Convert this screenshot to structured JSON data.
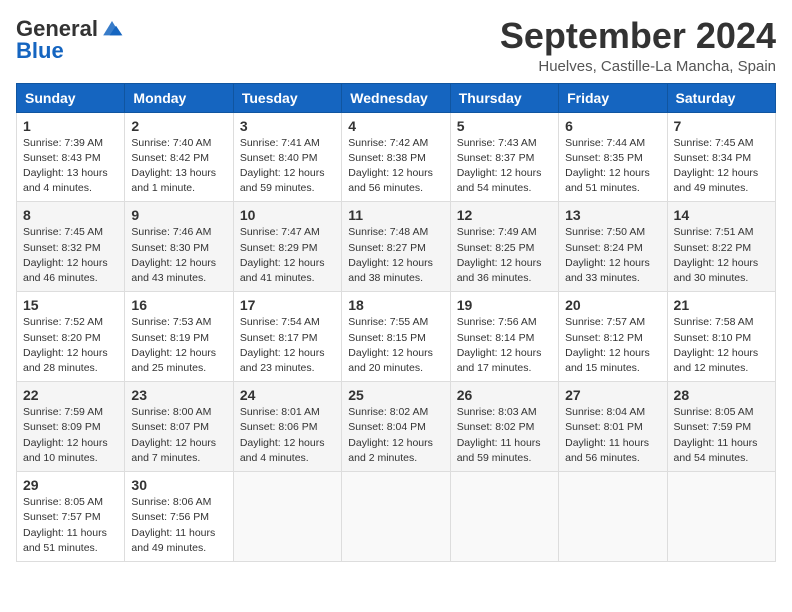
{
  "logo": {
    "general": "General",
    "blue": "Blue"
  },
  "title": {
    "month_year": "September 2024",
    "location": "Huelves, Castille-La Mancha, Spain"
  },
  "weekdays": [
    "Sunday",
    "Monday",
    "Tuesday",
    "Wednesday",
    "Thursday",
    "Friday",
    "Saturday"
  ],
  "weeks": [
    [
      {
        "day": "1",
        "info": "Sunrise: 7:39 AM\nSunset: 8:43 PM\nDaylight: 13 hours\nand 4 minutes."
      },
      {
        "day": "2",
        "info": "Sunrise: 7:40 AM\nSunset: 8:42 PM\nDaylight: 13 hours\nand 1 minute."
      },
      {
        "day": "3",
        "info": "Sunrise: 7:41 AM\nSunset: 8:40 PM\nDaylight: 12 hours\nand 59 minutes."
      },
      {
        "day": "4",
        "info": "Sunrise: 7:42 AM\nSunset: 8:38 PM\nDaylight: 12 hours\nand 56 minutes."
      },
      {
        "day": "5",
        "info": "Sunrise: 7:43 AM\nSunset: 8:37 PM\nDaylight: 12 hours\nand 54 minutes."
      },
      {
        "day": "6",
        "info": "Sunrise: 7:44 AM\nSunset: 8:35 PM\nDaylight: 12 hours\nand 51 minutes."
      },
      {
        "day": "7",
        "info": "Sunrise: 7:45 AM\nSunset: 8:34 PM\nDaylight: 12 hours\nand 49 minutes."
      }
    ],
    [
      {
        "day": "8",
        "info": "Sunrise: 7:45 AM\nSunset: 8:32 PM\nDaylight: 12 hours\nand 46 minutes."
      },
      {
        "day": "9",
        "info": "Sunrise: 7:46 AM\nSunset: 8:30 PM\nDaylight: 12 hours\nand 43 minutes."
      },
      {
        "day": "10",
        "info": "Sunrise: 7:47 AM\nSunset: 8:29 PM\nDaylight: 12 hours\nand 41 minutes."
      },
      {
        "day": "11",
        "info": "Sunrise: 7:48 AM\nSunset: 8:27 PM\nDaylight: 12 hours\nand 38 minutes."
      },
      {
        "day": "12",
        "info": "Sunrise: 7:49 AM\nSunset: 8:25 PM\nDaylight: 12 hours\nand 36 minutes."
      },
      {
        "day": "13",
        "info": "Sunrise: 7:50 AM\nSunset: 8:24 PM\nDaylight: 12 hours\nand 33 minutes."
      },
      {
        "day": "14",
        "info": "Sunrise: 7:51 AM\nSunset: 8:22 PM\nDaylight: 12 hours\nand 30 minutes."
      }
    ],
    [
      {
        "day": "15",
        "info": "Sunrise: 7:52 AM\nSunset: 8:20 PM\nDaylight: 12 hours\nand 28 minutes."
      },
      {
        "day": "16",
        "info": "Sunrise: 7:53 AM\nSunset: 8:19 PM\nDaylight: 12 hours\nand 25 minutes."
      },
      {
        "day": "17",
        "info": "Sunrise: 7:54 AM\nSunset: 8:17 PM\nDaylight: 12 hours\nand 23 minutes."
      },
      {
        "day": "18",
        "info": "Sunrise: 7:55 AM\nSunset: 8:15 PM\nDaylight: 12 hours\nand 20 minutes."
      },
      {
        "day": "19",
        "info": "Sunrise: 7:56 AM\nSunset: 8:14 PM\nDaylight: 12 hours\nand 17 minutes."
      },
      {
        "day": "20",
        "info": "Sunrise: 7:57 AM\nSunset: 8:12 PM\nDaylight: 12 hours\nand 15 minutes."
      },
      {
        "day": "21",
        "info": "Sunrise: 7:58 AM\nSunset: 8:10 PM\nDaylight: 12 hours\nand 12 minutes."
      }
    ],
    [
      {
        "day": "22",
        "info": "Sunrise: 7:59 AM\nSunset: 8:09 PM\nDaylight: 12 hours\nand 10 minutes."
      },
      {
        "day": "23",
        "info": "Sunrise: 8:00 AM\nSunset: 8:07 PM\nDaylight: 12 hours\nand 7 minutes."
      },
      {
        "day": "24",
        "info": "Sunrise: 8:01 AM\nSunset: 8:06 PM\nDaylight: 12 hours\nand 4 minutes."
      },
      {
        "day": "25",
        "info": "Sunrise: 8:02 AM\nSunset: 8:04 PM\nDaylight: 12 hours\nand 2 minutes."
      },
      {
        "day": "26",
        "info": "Sunrise: 8:03 AM\nSunset: 8:02 PM\nDaylight: 11 hours\nand 59 minutes."
      },
      {
        "day": "27",
        "info": "Sunrise: 8:04 AM\nSunset: 8:01 PM\nDaylight: 11 hours\nand 56 minutes."
      },
      {
        "day": "28",
        "info": "Sunrise: 8:05 AM\nSunset: 7:59 PM\nDaylight: 11 hours\nand 54 minutes."
      }
    ],
    [
      {
        "day": "29",
        "info": "Sunrise: 8:05 AM\nSunset: 7:57 PM\nDaylight: 11 hours\nand 51 minutes."
      },
      {
        "day": "30",
        "info": "Sunrise: 8:06 AM\nSunset: 7:56 PM\nDaylight: 11 hours\nand 49 minutes."
      },
      null,
      null,
      null,
      null,
      null
    ]
  ]
}
